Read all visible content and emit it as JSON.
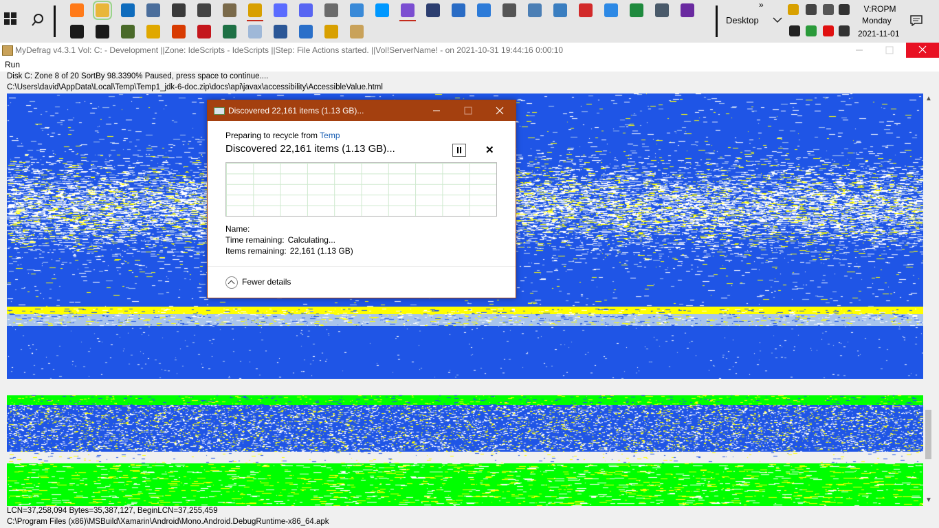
{
  "taskbar": {
    "desktop_label": "Desktop",
    "clock_time": "V:ROPM",
    "clock_day": "Monday",
    "clock_date": "2021-11-01",
    "overflow_glyph": "»",
    "row1_icons": [
      {
        "name": "firefox-icon",
        "color": "#ff7a1a"
      },
      {
        "name": "file-explorer-icon",
        "color": "#e9b63a",
        "active": true
      },
      {
        "name": "outlook-icon",
        "color": "#0f6cbd"
      },
      {
        "name": "tool-icon",
        "color": "#4b6e9c"
      },
      {
        "name": "printer-icon",
        "color": "#3a3a3a"
      },
      {
        "name": "printer-alt-icon",
        "color": "#444444"
      },
      {
        "name": "gimp-icon",
        "color": "#7a6a4a"
      },
      {
        "name": "document-app-icon",
        "color": "#d8a000"
      },
      {
        "name": "messenger-icon",
        "color": "#5b6cff"
      },
      {
        "name": "discord-icon",
        "color": "#5865f2"
      },
      {
        "name": "checkbox-app-icon",
        "color": "#6b6b6b"
      },
      {
        "name": "paint-icon",
        "color": "#3a8ad8"
      },
      {
        "name": "vscode-icon",
        "color": "#0098ff"
      },
      {
        "name": "visual-studio-icon",
        "color": "#7b4ed1"
      },
      {
        "name": "server-app-icon",
        "color": "#2c3e70"
      },
      {
        "name": "powershell-icon",
        "color": "#2a6cc5"
      },
      {
        "name": "calculator-icon",
        "color": "#2d7bd8"
      },
      {
        "name": "gear-icon",
        "color": "#555555"
      },
      {
        "name": "remote-desktop-icon",
        "color": "#4c7fb5"
      },
      {
        "name": "network-app-icon",
        "color": "#3a7ec0"
      },
      {
        "name": "pdf-app-icon",
        "color": "#d22a2a"
      },
      {
        "name": "todo-icon",
        "color": "#2d89e5"
      },
      {
        "name": "green-app-icon",
        "color": "#1f8a3e"
      },
      {
        "name": "monitor-app-icon",
        "color": "#4a5a6a"
      },
      {
        "name": "purple-app-icon",
        "color": "#6a2aa0"
      }
    ],
    "row2_icons": [
      {
        "name": "command-prompt-icon",
        "color": "#1a1a1a"
      },
      {
        "name": "command-prompt-alt-icon",
        "color": "#1a1a1a"
      },
      {
        "name": "tree-app-icon",
        "color": "#4a6a2a"
      },
      {
        "name": "chrome-icon",
        "color": "#e0a800"
      },
      {
        "name": "office-icon",
        "color": "#d83b01"
      },
      {
        "name": "acrobat-icon",
        "color": "#c4161c"
      },
      {
        "name": "excel-icon",
        "color": "#1e7145"
      },
      {
        "name": "notepad-icon",
        "color": "#9fb8d8"
      },
      {
        "name": "word-icon",
        "color": "#2b5797"
      },
      {
        "name": "text-doc-icon",
        "color": "#2a6fc9"
      },
      {
        "name": "help-app-icon",
        "color": "#d8a000"
      },
      {
        "name": "mydefrag-icon",
        "color": "#c9a25a"
      }
    ],
    "tray_icons": [
      {
        "name": "document-tray-icon",
        "color": "#d8a000"
      },
      {
        "name": "printer-tray-icon",
        "color": "#444444"
      },
      {
        "name": "usb-tray-icon",
        "color": "#555555"
      },
      {
        "name": "volume-icon",
        "color": "#333333"
      },
      {
        "name": "microphone-icon",
        "color": "#222222"
      },
      {
        "name": "green-tray-icon",
        "color": "#2a9a3a"
      },
      {
        "name": "red-tray-icon",
        "color": "#e01010"
      },
      {
        "name": "network-tray-icon",
        "color": "#333333"
      }
    ]
  },
  "window": {
    "title": "MyDefrag v4.3.1    Vol: C: - Development ||Zone: IdeScripts - IdeScripts ||Step: File Actions started. ||Vol!ServerName! -  on 2021-10-31 19:44:16 0:00:10",
    "menu_run": "Run",
    "info_line1": "Disk C:    Zone 8 of 20    SortBy    98.3390%    Paused, press space to continue....",
    "info_line2": "C:\\Users\\david\\AppData\\Local\\Temp\\Temp1_jdk-6-doc.zip\\docs\\api\\javax\\accessibility\\AccessibleValue.html",
    "status_line1": "LCN=37,258,094    Bytes=35,387,127, BeginLCN=37,255,459",
    "status_line2": "C:\\Program Files (x86)\\MSBuild\\Xamarin\\Android\\Mono.Android.DebugRuntime-x86_64.apk"
  },
  "diskmap_colors": {
    "blue": "#1f55e6",
    "white": "#ffffff",
    "yellow": "#ffff00",
    "green": "#00ff00",
    "light_blue": "#a8c4ec",
    "gray": "#f0f0f0"
  },
  "dialog": {
    "title": "Discovered 22,161 items (1.13 GB)...",
    "preparing_prefix": "Preparing to recycle from ",
    "preparing_link": "Temp",
    "headline": "Discovered 22,161 items (1.13 GB)...",
    "name_label": "Name:",
    "name_value": "",
    "time_label": "Time remaining:",
    "time_value": "Calculating...",
    "items_label": "Items remaining:",
    "items_value": "22,161 (1.13 GB)",
    "fewer_details": "Fewer details",
    "accent_color": "#a4400f"
  }
}
